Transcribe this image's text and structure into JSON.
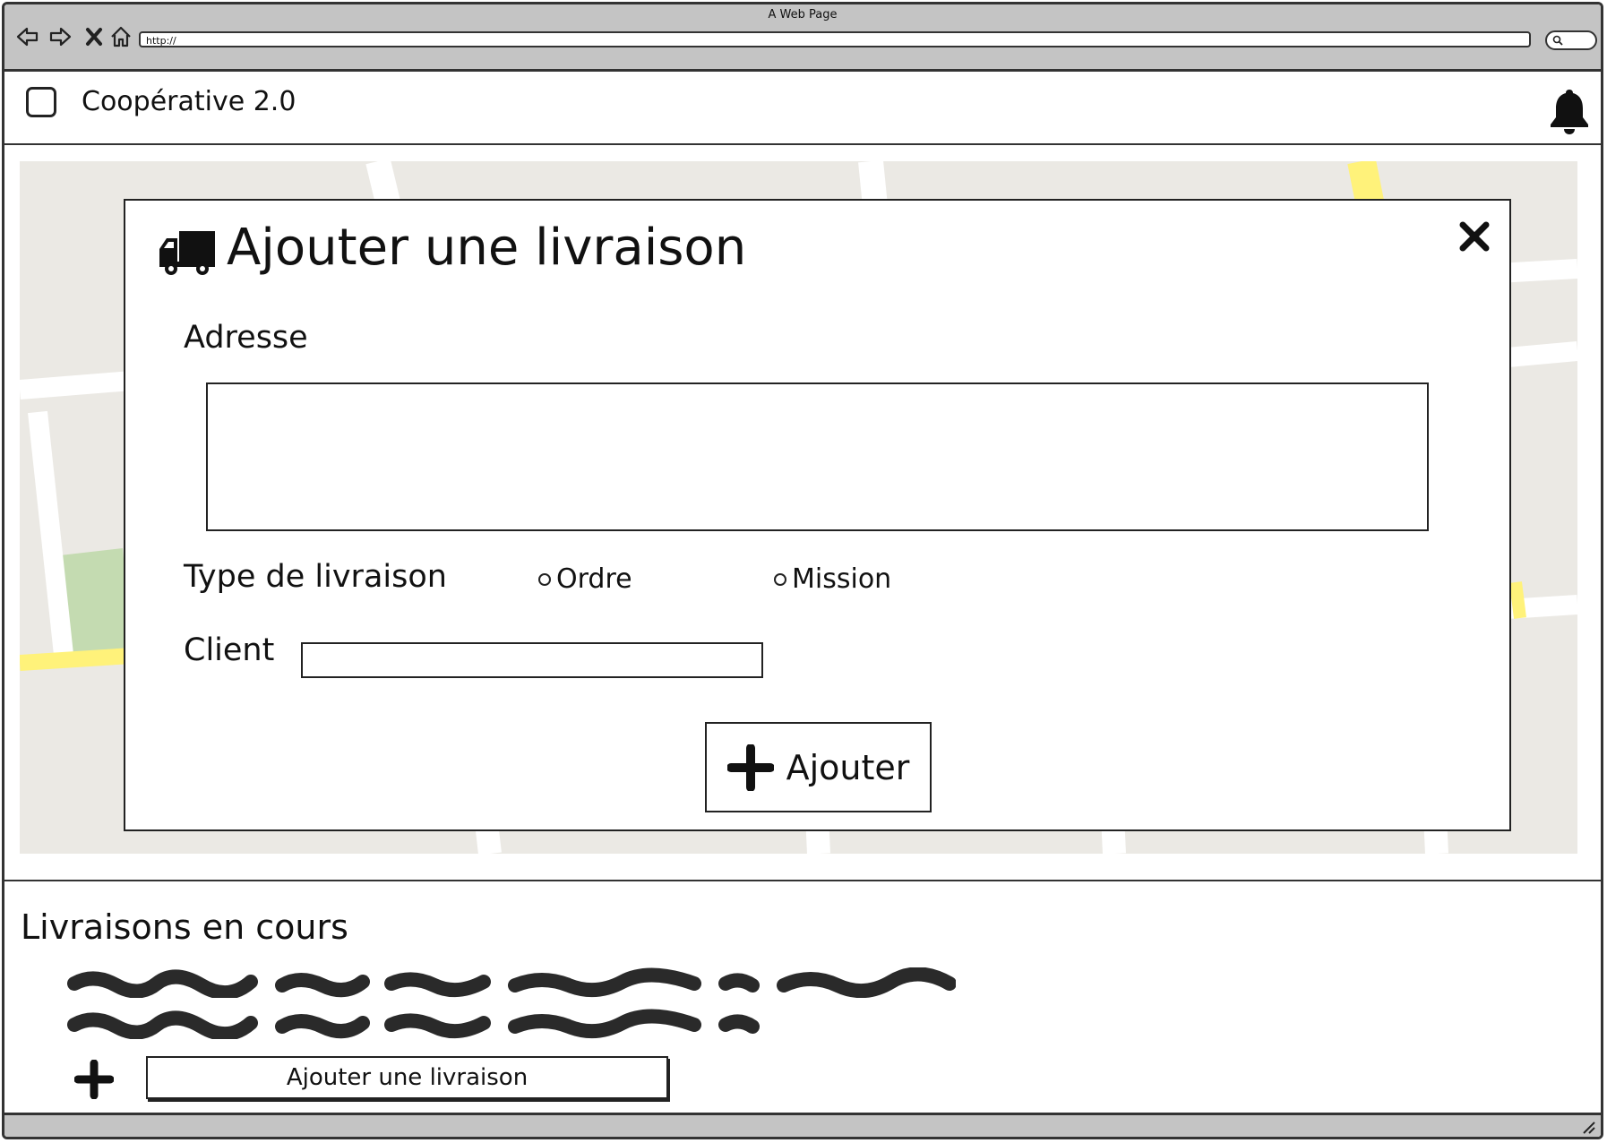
{
  "window": {
    "title": "A Web Page",
    "url": "http://"
  },
  "header": {
    "app_title": "Coopérative 2.0"
  },
  "modal": {
    "title": "Ajouter une livraison",
    "address_label": "Adresse",
    "address_value": "",
    "type_label": "Type de livraison",
    "type_options": [
      "Ordre",
      "Mission"
    ],
    "client_label": "Client",
    "client_value": "",
    "submit_label": "Ajouter"
  },
  "deliveries": {
    "title": "Livraisons en cours",
    "add_label": "Ajouter une livraison"
  },
  "colors": {
    "map_bg": "#ebe9e4",
    "road": "#ffffff",
    "major_road": "#fff27a",
    "park": "#c4dbb1",
    "chrome": "#c4c4c4"
  },
  "icons": [
    "back-icon",
    "forward-icon",
    "stop-icon",
    "home-icon",
    "search-icon",
    "menu-icon",
    "bell-icon",
    "truck-icon",
    "close-icon",
    "plus-icon",
    "resize-grip-icon"
  ]
}
